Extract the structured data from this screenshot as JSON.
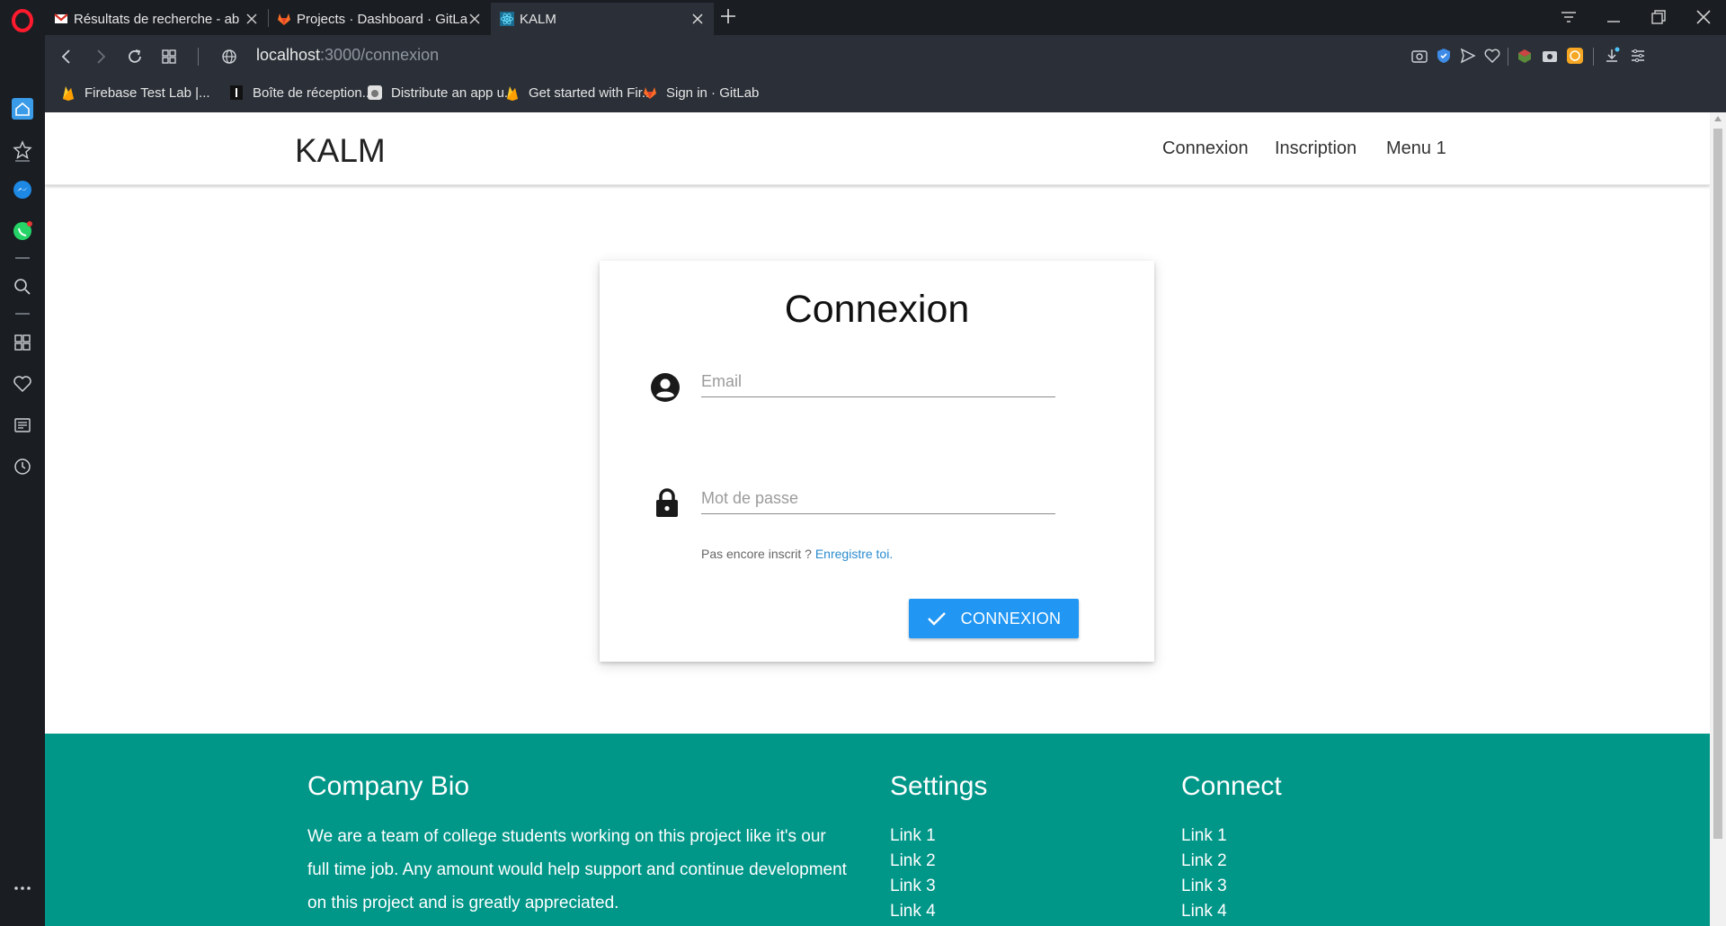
{
  "browser": {
    "tabs": [
      {
        "title": "Résultats de recherche - ab"
      },
      {
        "title": "Projects · Dashboard · GitLa"
      },
      {
        "title": "KALM"
      }
    ],
    "url_host": "localhost",
    "url_path": ":3000/connexion",
    "bookmarks": [
      {
        "label": "Firebase Test Lab  |..."
      },
      {
        "label": "Boîte de réception..."
      },
      {
        "label": "Distribute an app u..."
      },
      {
        "label": "Get started with Fir..."
      },
      {
        "label": "Sign in · GitLab"
      }
    ]
  },
  "navbar": {
    "brand": "KALM",
    "links": [
      "Connexion",
      "Inscription",
      "Menu 1"
    ]
  },
  "login": {
    "title": "Connexion",
    "email_placeholder": "Email",
    "password_placeholder": "Mot de passe",
    "register_prompt": "Pas encore inscrit ? ",
    "register_link": "Enregistre toi.",
    "submit_label": "CONNEXION"
  },
  "footer": {
    "bio_title": "Company Bio",
    "bio_text": "We are a team of college students working on this project like it's our full time job. Any amount would help support and continue development on this project and is greatly appreciated.",
    "settings_title": "Settings",
    "settings_links": [
      "Link 1",
      "Link 2",
      "Link 3",
      "Link 4"
    ],
    "connect_title": "Connect",
    "connect_links": [
      "Link 1",
      "Link 2",
      "Link 3",
      "Link 4"
    ]
  },
  "colors": {
    "footer_bg": "#009688",
    "button_bg": "#2196f3",
    "link": "#2a8ccf",
    "browser_dark": "#1a1d22"
  }
}
